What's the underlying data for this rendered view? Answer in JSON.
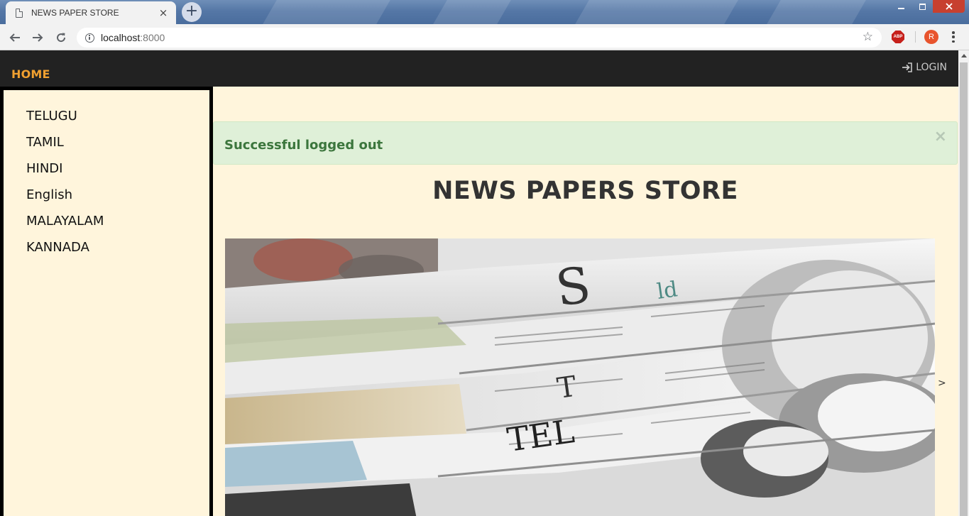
{
  "browser": {
    "tab_title": "NEWS PAPER STORE",
    "tab_close": "×",
    "new_tab": "+",
    "url_host": "localhost",
    "url_port": ":8000",
    "extension_label": "ABP",
    "profile_initial": "R"
  },
  "navbar": {
    "home_label": "HOME",
    "login_label": "LOGIN"
  },
  "sidebar": {
    "items": [
      {
        "label": "TELUGU"
      },
      {
        "label": "TAMIL"
      },
      {
        "label": "HINDI"
      },
      {
        "label": "English"
      },
      {
        "label": "MALAYALAM"
      },
      {
        "label": "KANNADA"
      }
    ]
  },
  "alert": {
    "message": "Successful logged out",
    "close_symbol": "×",
    "type": "success"
  },
  "main": {
    "title": "NEWS PAPERS STORE",
    "carousel_image": "stack-of-newspapers-photo",
    "next_arrow": ">"
  },
  "colors": {
    "navbar_bg": "#222222",
    "home_accent": "#f0a030",
    "page_bg": "#fff5dc",
    "alert_bg": "#dff0d8",
    "alert_text": "#3c763d"
  }
}
